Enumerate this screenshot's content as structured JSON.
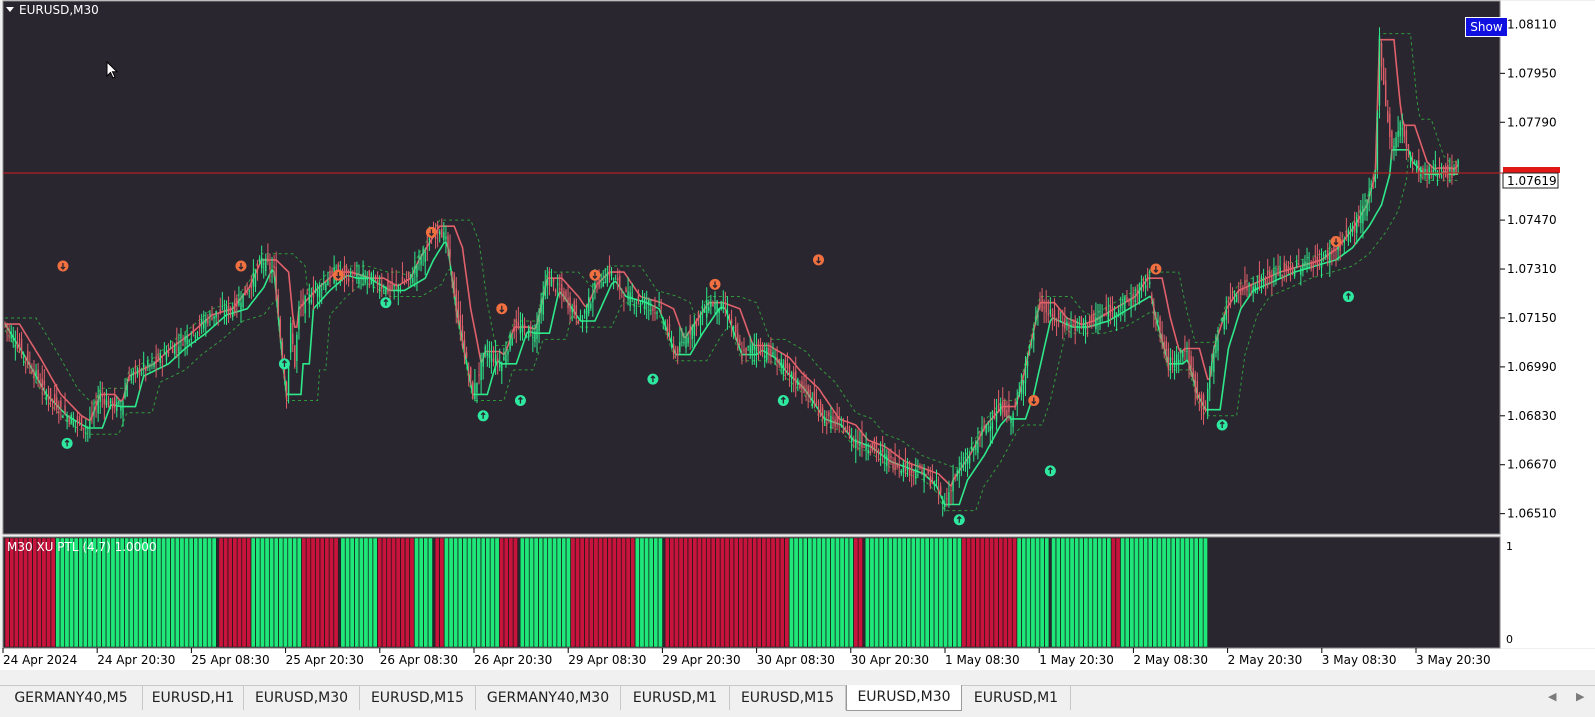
{
  "window": {
    "symbol_title": "EURUSD,M30",
    "show_button": "Show"
  },
  "price_axis": {
    "labels": [
      "1.08110",
      "1.07950",
      "1.07790",
      "1.07470",
      "1.07310",
      "1.07150",
      "1.06990",
      "1.06830",
      "1.06670",
      "1.06510"
    ],
    "current_price_label": "1.07619",
    "current_price_value": 1.07619
  },
  "indicator": {
    "label": "M30 XU PTL (4,7) 1.0000",
    "axis_top": "1",
    "axis_bottom": "0",
    "segments": [
      {
        "color": "red",
        "bars": 11
      },
      {
        "color": "green",
        "bars": 35
      },
      {
        "color": "red",
        "bars": 7
      },
      {
        "color": "green",
        "bars": 11
      },
      {
        "color": "red",
        "bars": 8
      },
      {
        "color": "green",
        "bars": 8
      },
      {
        "color": "red",
        "bars": 8
      },
      {
        "color": "green",
        "bars": 4
      },
      {
        "color": "red",
        "bars": 2
      },
      {
        "color": "green",
        "bars": 12
      },
      {
        "color": "red",
        "bars": 4
      },
      {
        "color": "green",
        "bars": 11
      },
      {
        "color": "red",
        "bars": 14
      },
      {
        "color": "green",
        "bars": 6
      },
      {
        "color": "red",
        "bars": 27
      },
      {
        "color": "green",
        "bars": 14
      },
      {
        "color": "red",
        "bars": 2
      },
      {
        "color": "green",
        "bars": 21
      },
      {
        "color": "red",
        "bars": 12
      },
      {
        "color": "green",
        "bars": 7
      },
      {
        "color": "green",
        "bars": 13
      },
      {
        "color": "red",
        "bars": 2
      },
      {
        "color": "green",
        "bars": 19
      }
    ]
  },
  "time_axis": {
    "labels": [
      "24 Apr 2024",
      "24 Apr 20:30",
      "25 Apr 08:30",
      "25 Apr 20:30",
      "26 Apr 08:30",
      "26 Apr 20:30",
      "29 Apr 08:30",
      "29 Apr 20:30",
      "30 Apr 08:30",
      "30 Apr 20:30",
      "1 May 08:30",
      "1 May 20:30",
      "2 May 08:30",
      "2 May 20:30",
      "3 May 08:30",
      "3 May 20:30"
    ]
  },
  "tabs": [
    {
      "label": "GERMANY40,M5",
      "active": false
    },
    {
      "label": "EURUSD,H1",
      "active": false
    },
    {
      "label": "EURUSD,M30",
      "active": false
    },
    {
      "label": "EURUSD,M15",
      "active": false
    },
    {
      "label": "GERMANY40,M30",
      "active": false
    },
    {
      "label": "EURUSD,M1",
      "active": false
    },
    {
      "label": "EURUSD,M15",
      "active": false
    },
    {
      "label": "EURUSD,M30",
      "active": true
    },
    {
      "label": "EURUSD,M1",
      "active": false
    }
  ],
  "colors": {
    "background": "#2a2630",
    "bull": "#2ee88a",
    "bear": "#e0606a",
    "indicator_green": "#1ee87a",
    "indicator_red": "#c8143c",
    "price_line": "#d02020"
  },
  "chart_data": {
    "type": "candlestick",
    "y_range": [
      1.0645,
      1.0818
    ],
    "path": [
      [
        0,
        1.0713
      ],
      [
        10,
        1.0702
      ],
      [
        20,
        1.069
      ],
      [
        30,
        1.0683
      ],
      [
        40,
        1.0679
      ],
      [
        46,
        1.069
      ],
      [
        50,
        1.0687
      ],
      [
        56,
        1.0686
      ],
      [
        60,
        1.0696
      ],
      [
        72,
        1.07
      ],
      [
        80,
        1.0705
      ],
      [
        90,
        1.071
      ],
      [
        100,
        1.0716
      ],
      [
        110,
        1.0718
      ],
      [
        118,
        1.0725
      ],
      [
        124,
        1.0734
      ],
      [
        130,
        1.073
      ],
      [
        134,
        1.0702
      ],
      [
        136,
        1.069
      ],
      [
        138,
        1.0712
      ],
      [
        140,
        1.07
      ],
      [
        142,
        1.0718
      ],
      [
        150,
        1.0724
      ],
      [
        160,
        1.073
      ],
      [
        170,
        1.0728
      ],
      [
        176,
        1.0728
      ],
      [
        186,
        1.0724
      ],
      [
        196,
        1.0728
      ],
      [
        200,
        1.0734
      ],
      [
        210,
        1.0745
      ],
      [
        214,
        1.0738
      ],
      [
        218,
        1.0718
      ],
      [
        226,
        1.069
      ],
      [
        232,
        1.0704
      ],
      [
        240,
        1.07
      ],
      [
        246,
        1.0712
      ],
      [
        256,
        1.071
      ],
      [
        262,
        1.0728
      ],
      [
        270,
        1.0722
      ],
      [
        278,
        1.0714
      ],
      [
        286,
        1.0726
      ],
      [
        292,
        1.073
      ],
      [
        300,
        1.0722
      ],
      [
        310,
        1.072
      ],
      [
        316,
        1.0718
      ],
      [
        324,
        1.0703
      ],
      [
        330,
        1.071
      ],
      [
        340,
        1.072
      ],
      [
        348,
        1.0718
      ],
      [
        356,
        1.0703
      ],
      [
        362,
        1.0706
      ],
      [
        372,
        1.0702
      ],
      [
        378,
        1.0697
      ],
      [
        386,
        1.0692
      ],
      [
        396,
        1.0682
      ],
      [
        404,
        1.068
      ],
      [
        410,
        1.0675
      ],
      [
        418,
        1.0673
      ],
      [
        428,
        1.0668
      ],
      [
        436,
        1.0666
      ],
      [
        444,
        1.0664
      ],
      [
        450,
        1.066
      ],
      [
        454,
        1.0654
      ],
      [
        458,
        1.0662
      ],
      [
        466,
        1.067
      ],
      [
        474,
        1.068
      ],
      [
        482,
        1.0686
      ],
      [
        486,
        1.0682
      ],
      [
        490,
        1.069
      ],
      [
        496,
        1.0708
      ],
      [
        500,
        1.072
      ],
      [
        506,
        1.0715
      ],
      [
        516,
        1.0712
      ],
      [
        526,
        1.0714
      ],
      [
        536,
        1.0718
      ],
      [
        546,
        1.0722
      ],
      [
        552,
        1.0728
      ],
      [
        556,
        1.0715
      ],
      [
        562,
        1.07
      ],
      [
        570,
        1.0705
      ],
      [
        576,
        1.069
      ],
      [
        580,
        1.0685
      ],
      [
        584,
        1.0705
      ],
      [
        590,
        1.0718
      ],
      [
        596,
        1.0724
      ],
      [
        606,
        1.0727
      ],
      [
        616,
        1.073
      ],
      [
        626,
        1.0732
      ],
      [
        636,
        1.0734
      ],
      [
        644,
        1.0738
      ],
      [
        652,
        1.0745
      ],
      [
        658,
        1.0752
      ],
      [
        662,
        1.0762
      ],
      [
        664,
        1.0806
      ],
      [
        667,
        1.0785
      ],
      [
        670,
        1.077
      ],
      [
        674,
        1.0778
      ],
      [
        680,
        1.0766
      ],
      [
        686,
        1.0762
      ],
      [
        692,
        1.0764
      ],
      [
        698,
        1.0762
      ],
      [
        702,
        1.0765
      ]
    ],
    "arrows": [
      {
        "bar": 28,
        "dir": "down",
        "price": 1.0732
      },
      {
        "bar": 114,
        "dir": "down",
        "price": 1.0732
      },
      {
        "bar": 161,
        "dir": "down",
        "price": 1.0729
      },
      {
        "bar": 206,
        "dir": "down",
        "price": 1.0743
      },
      {
        "bar": 240,
        "dir": "down",
        "price": 1.0718
      },
      {
        "bar": 285,
        "dir": "down",
        "price": 1.0729
      },
      {
        "bar": 343,
        "dir": "down",
        "price": 1.0726
      },
      {
        "bar": 393,
        "dir": "down",
        "price": 1.0734
      },
      {
        "bar": 497,
        "dir": "down",
        "price": 1.0688
      },
      {
        "bar": 556,
        "dir": "down",
        "price": 1.0731
      },
      {
        "bar": 643,
        "dir": "down",
        "price": 1.074
      },
      {
        "bar": 30,
        "dir": "up",
        "price": 1.0674
      },
      {
        "bar": 135,
        "dir": "up",
        "price": 1.07
      },
      {
        "bar": 184,
        "dir": "up",
        "price": 1.072
      },
      {
        "bar": 231,
        "dir": "up",
        "price": 1.0683
      },
      {
        "bar": 249,
        "dir": "up",
        "price": 1.0688
      },
      {
        "bar": 313,
        "dir": "up",
        "price": 1.0695
      },
      {
        "bar": 376,
        "dir": "up",
        "price": 1.0688
      },
      {
        "bar": 461,
        "dir": "up",
        "price": 1.0649
      },
      {
        "bar": 505,
        "dir": "up",
        "price": 1.0665
      },
      {
        "bar": 588,
        "dir": "up",
        "price": 1.068
      },
      {
        "bar": 649,
        "dir": "up",
        "price": 1.0722
      }
    ]
  }
}
